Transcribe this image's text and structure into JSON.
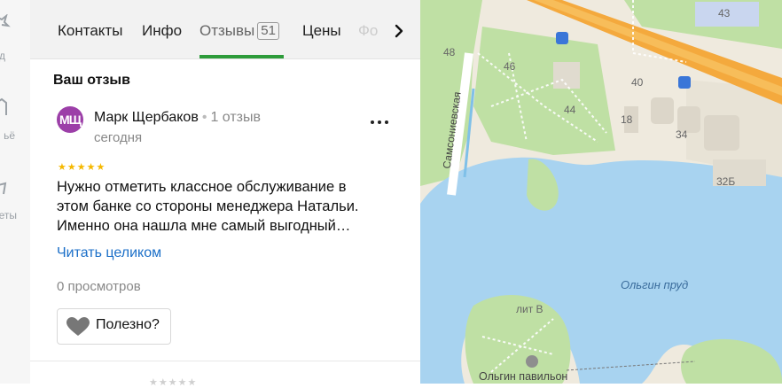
{
  "leftnav": {
    "items": [
      {
        "label": "д",
        "icon": "star-icon"
      },
      {
        "label": "ьё",
        "icon": "bookmark-icon"
      },
      {
        "label": "еты",
        "icon": "route-icon"
      }
    ]
  },
  "tabs": {
    "items": [
      {
        "label": "Контакты"
      },
      {
        "label": "Инфо"
      },
      {
        "label": "Отзывы",
        "badge": "51",
        "active": true
      },
      {
        "label": "Цены"
      }
    ],
    "faded_label": "Фо"
  },
  "review_section": {
    "title": "Ваш отзыв",
    "review": {
      "avatar_initials": "МЩ",
      "author": "Марк Щербаков",
      "author_reviews": "1 отзыв",
      "date": "сегодня",
      "rating_stars": "★★★★★",
      "rating": 5,
      "text": "Нужно отметить классное обслуживание в этом банке со стороны менеджера Натальи. Именно она нашла мне самый выгодный…",
      "read_more": "Читать целиком",
      "views": "0 просмотров",
      "useful_label": "Полезно?"
    },
    "next_review_stars": "★★★★★"
  },
  "map": {
    "labels": {
      "b43": "43",
      "b48": "48",
      "b46": "46",
      "b40": "40",
      "b44": "44",
      "b18": "18",
      "b34": "34",
      "b32b": "32Б",
      "street": "Самсониевская",
      "pond": "Ольгин пруд",
      "litv": "лит В",
      "pavilion": "Ольгин павильон"
    },
    "colors": {
      "water": "#a8d3f0",
      "park": "#bfe0a4",
      "road": "#f4a93d",
      "ground": "#efeade",
      "building": "#dcd6c9"
    }
  }
}
